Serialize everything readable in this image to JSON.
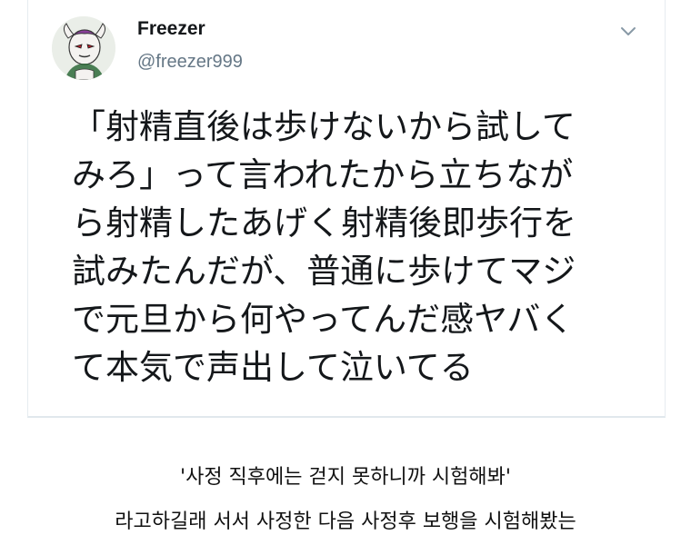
{
  "tweet": {
    "author_name": "Freezer",
    "author_handle": "@freezer999",
    "menu_icon": "chevron-down-icon",
    "avatar_icon": "avatar-character-icon",
    "text_lines": [
      "「射精直後は歩けないから試して",
      "みろ」って言われたから立ちなが",
      "ら射精したあげく射精後即歩行を",
      "試みたんだが、普通に歩けてマジ",
      "で元旦から何やってんだ感ヤバく",
      "て本気で声出して泣いてる"
    ]
  },
  "caption": {
    "line1": "'사정 직후에는 걷지 못하니까 시험해봐'",
    "line2": "라고하길래 서서 사정한 다음 사정후 보행을 시험해봤는"
  },
  "colors": {
    "text_primary": "#14171a",
    "text_secondary": "#657786",
    "border": "#e1e8ed",
    "chevron": "#8899a6"
  }
}
